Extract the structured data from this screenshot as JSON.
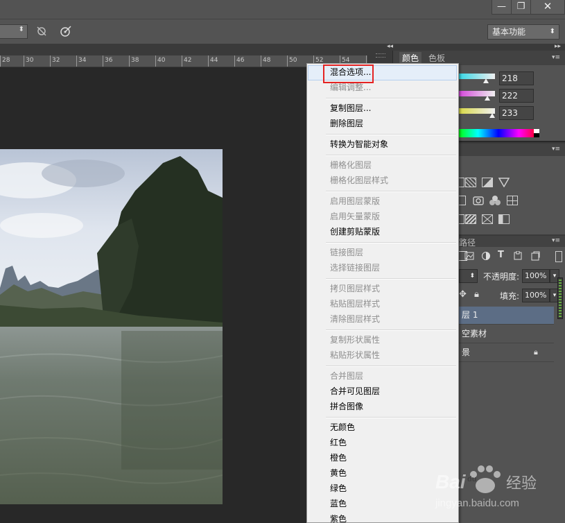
{
  "window": {
    "minimize_icon": "minimize-icon",
    "maximize_icon": "restore-icon",
    "close_icon": "close-icon",
    "minimize_glyph": "—",
    "maximize_glyph": "❐",
    "close_glyph": "✕"
  },
  "options_bar": {
    "workspace": "基本功能",
    "dropdown_arrow": "⬍"
  },
  "ruler": {
    "labels": [
      "28",
      "30",
      "32",
      "34",
      "36",
      "38",
      "40",
      "42",
      "44",
      "46",
      "48",
      "50",
      "52",
      "54"
    ]
  },
  "panels": {
    "color": {
      "tabs": [
        "颜色",
        "色板"
      ],
      "values": [
        "218",
        "222",
        "233"
      ]
    },
    "layers": {
      "tab_label": "路径",
      "opacity_label": "不透明度:",
      "opacity_value": "100%",
      "fill_label": "填充:",
      "fill_value": "100%",
      "layers": [
        "层 1",
        "空素材",
        "景"
      ]
    }
  },
  "context_menu": {
    "items": [
      {
        "label": "混合选项...",
        "enabled": true
      },
      {
        "label": "编辑调整...",
        "enabled": false
      },
      {
        "label": "复制图层...",
        "enabled": true
      },
      {
        "label": "删除图层",
        "enabled": true
      },
      {
        "label": "转换为智能对象",
        "enabled": true
      },
      {
        "label": "栅格化图层",
        "enabled": false
      },
      {
        "label": "栅格化图层样式",
        "enabled": false
      },
      {
        "label": "启用图层蒙版",
        "enabled": false
      },
      {
        "label": "启用矢量蒙版",
        "enabled": false
      },
      {
        "label": "创建剪贴蒙版",
        "enabled": true
      },
      {
        "label": "链接图层",
        "enabled": false
      },
      {
        "label": "选择链接图层",
        "enabled": false
      },
      {
        "label": "拷贝图层样式",
        "enabled": false
      },
      {
        "label": "粘贴图层样式",
        "enabled": false
      },
      {
        "label": "清除图层样式",
        "enabled": false
      },
      {
        "label": "复制形状属性",
        "enabled": false
      },
      {
        "label": "粘贴形状属性",
        "enabled": false
      },
      {
        "label": "合并图层",
        "enabled": false
      },
      {
        "label": "合并可见图层",
        "enabled": true
      },
      {
        "label": "拼合图像",
        "enabled": true
      },
      {
        "label": "无颜色",
        "enabled": true
      },
      {
        "label": "红色",
        "enabled": true
      },
      {
        "label": "橙色",
        "enabled": true
      },
      {
        "label": "黄色",
        "enabled": true
      },
      {
        "label": "绿色",
        "enabled": true
      },
      {
        "label": "蓝色",
        "enabled": true
      },
      {
        "label": "紫色",
        "enabled": true
      }
    ],
    "highlight_color": "#e52222"
  },
  "watermark": {
    "brand_prefix": "Bai",
    "brand_suffix": "经验",
    "url": "jingyan.baidu.com"
  }
}
